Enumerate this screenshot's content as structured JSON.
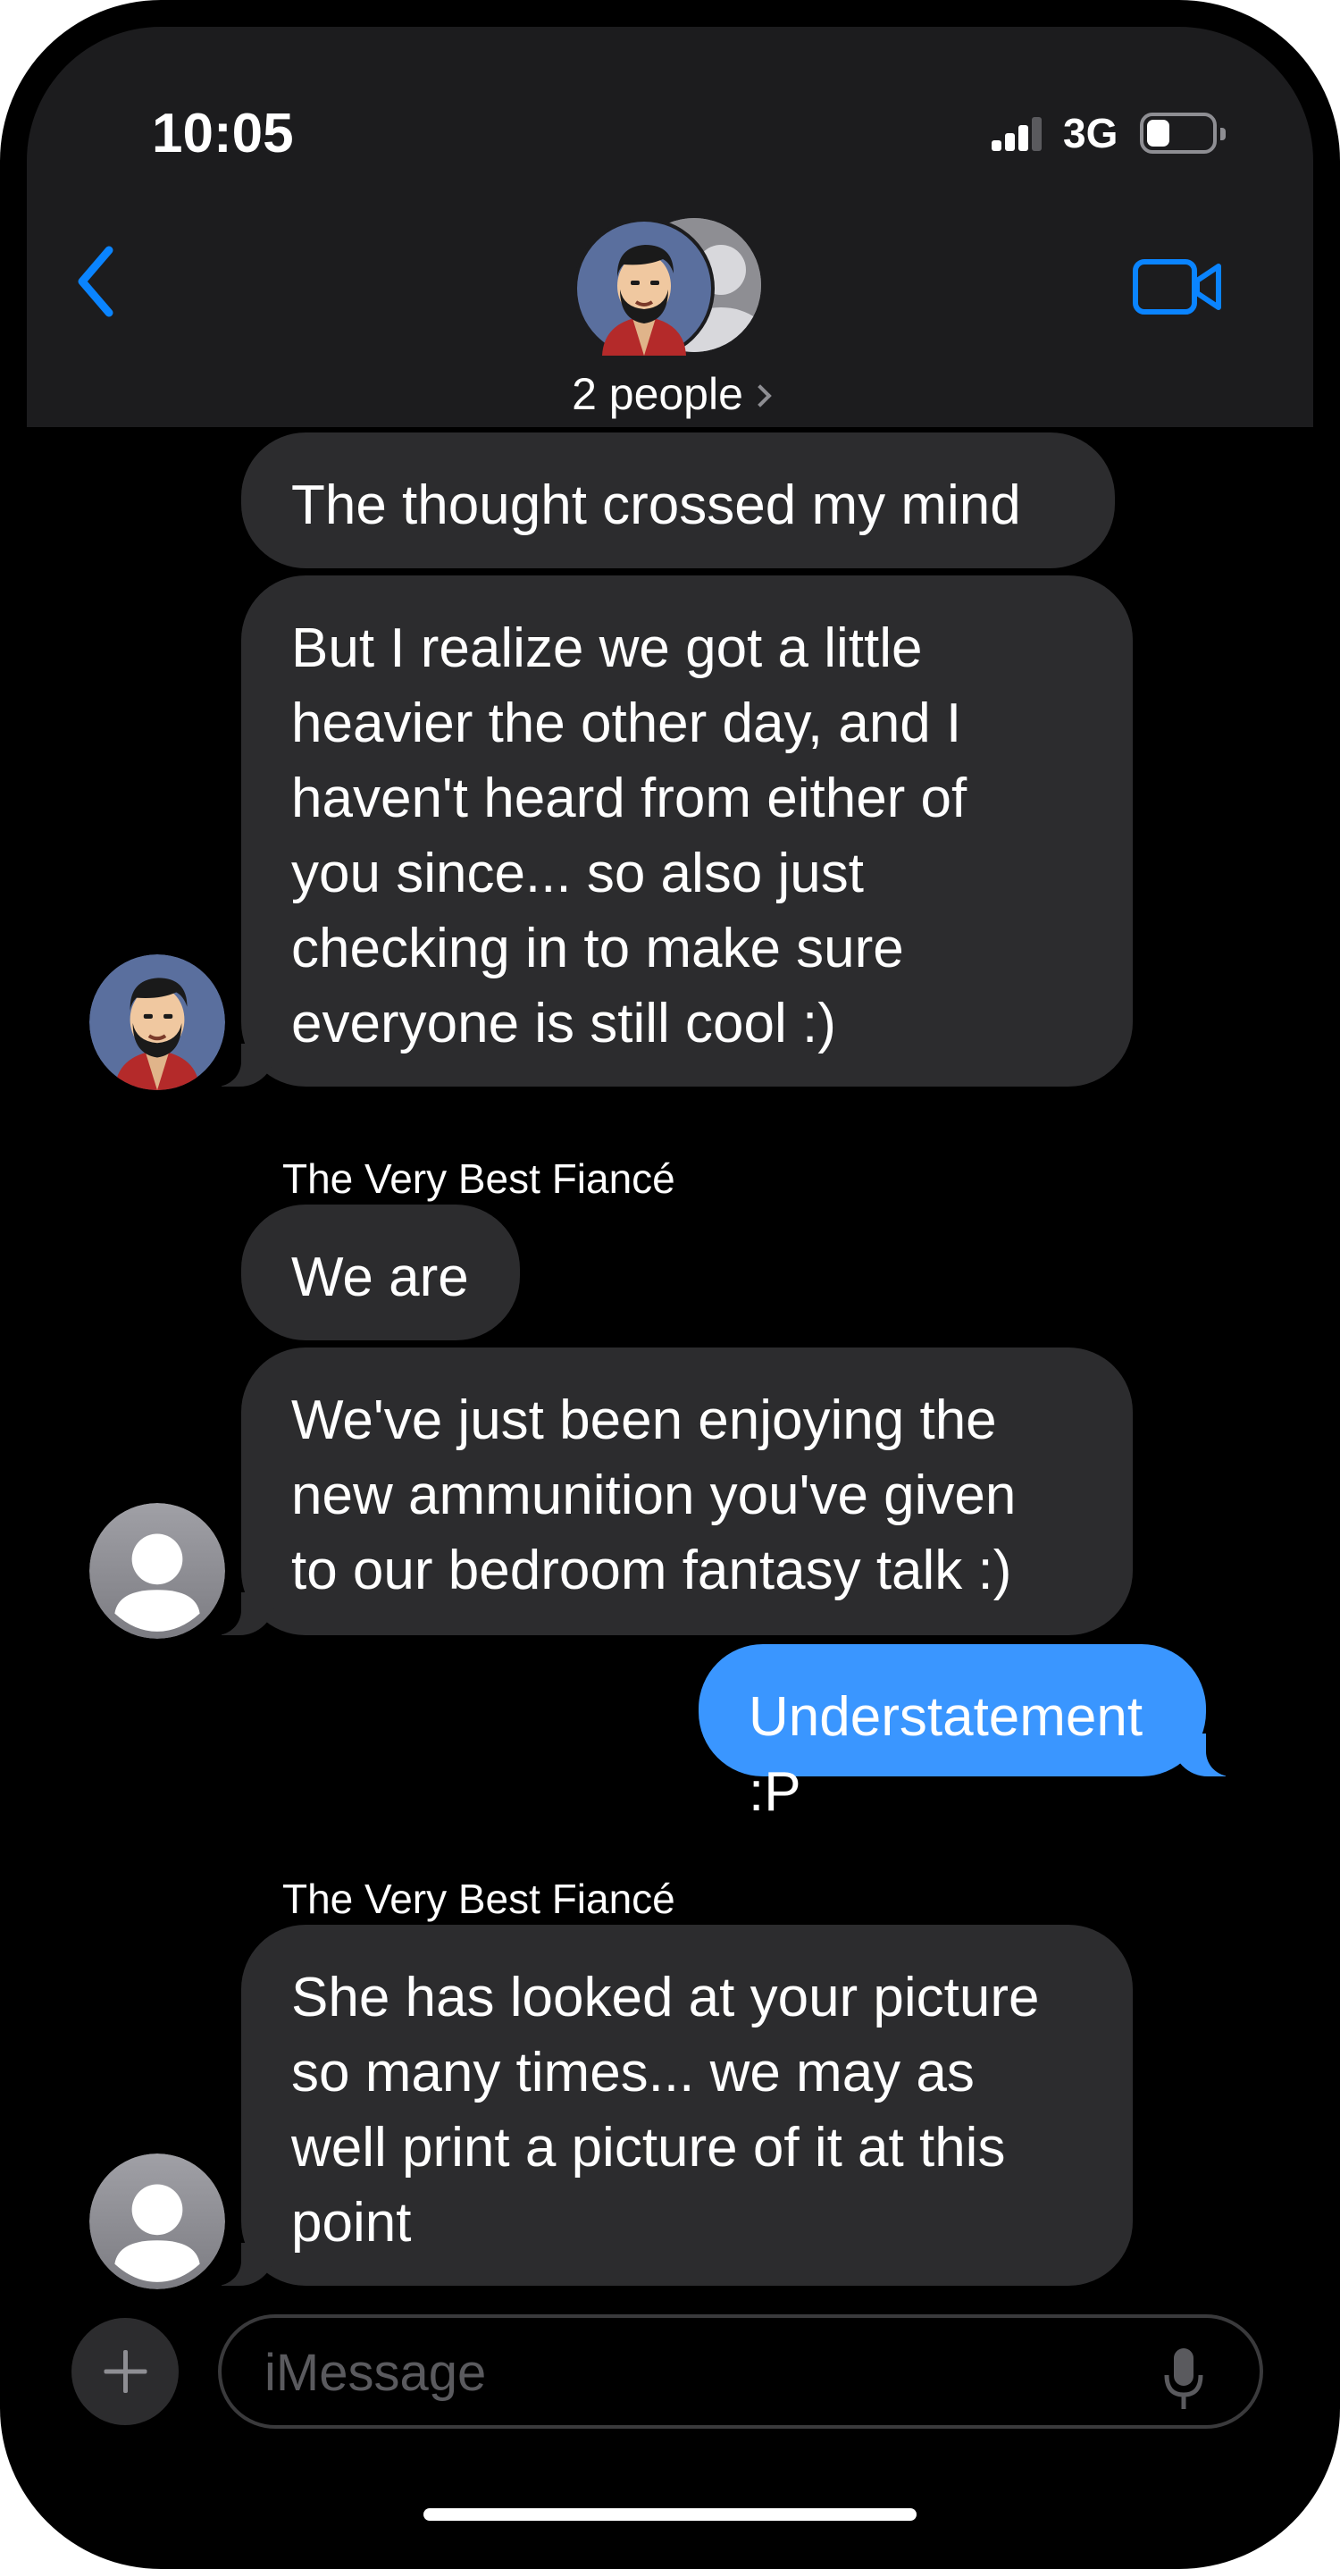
{
  "status_bar": {
    "time": "10:05",
    "network": "3G",
    "signal_bars": 4,
    "signal_bars_lit": 3,
    "battery_level": 0.35
  },
  "header": {
    "subtitle": "2 people",
    "back_icon": "chevron-left-icon",
    "video_icon": "video-camera-icon"
  },
  "messages": [
    {
      "from": "contact-1",
      "text": "The thought crossed my mind"
    },
    {
      "from": "contact-1",
      "lines": [
        "But I realize we got a little",
        "heavier the other day, and I",
        "haven't heard from either of",
        "you since... so also just",
        "checking in to make sure",
        "everyone is still cool :)"
      ]
    },
    {
      "sender_name": "The Very Best Fiancé"
    },
    {
      "from": "contact-2",
      "text": "We are"
    },
    {
      "from": "contact-2",
      "lines": [
        "We've just been enjoying the",
        "new ammunition you've given",
        "to our bedroom fantasy talk :)"
      ]
    },
    {
      "from": "me",
      "text": "Understatement :P"
    },
    {
      "sender_name": "The Very Best Fiancé"
    },
    {
      "from": "contact-2",
      "lines": [
        "She has looked at your picture",
        "so many times... we may as",
        "well print a picture of it at this",
        "point"
      ]
    }
  ],
  "composer": {
    "placeholder": "iMessage",
    "plus_icon": "plus-icon",
    "mic_icon": "microphone-icon"
  },
  "colors": {
    "background": "#000000",
    "header": "#1c1c1e",
    "incoming_bubble": "#2c2c2e",
    "outgoing_bubble": "#3a96ff",
    "accent": "#0a84ff"
  }
}
